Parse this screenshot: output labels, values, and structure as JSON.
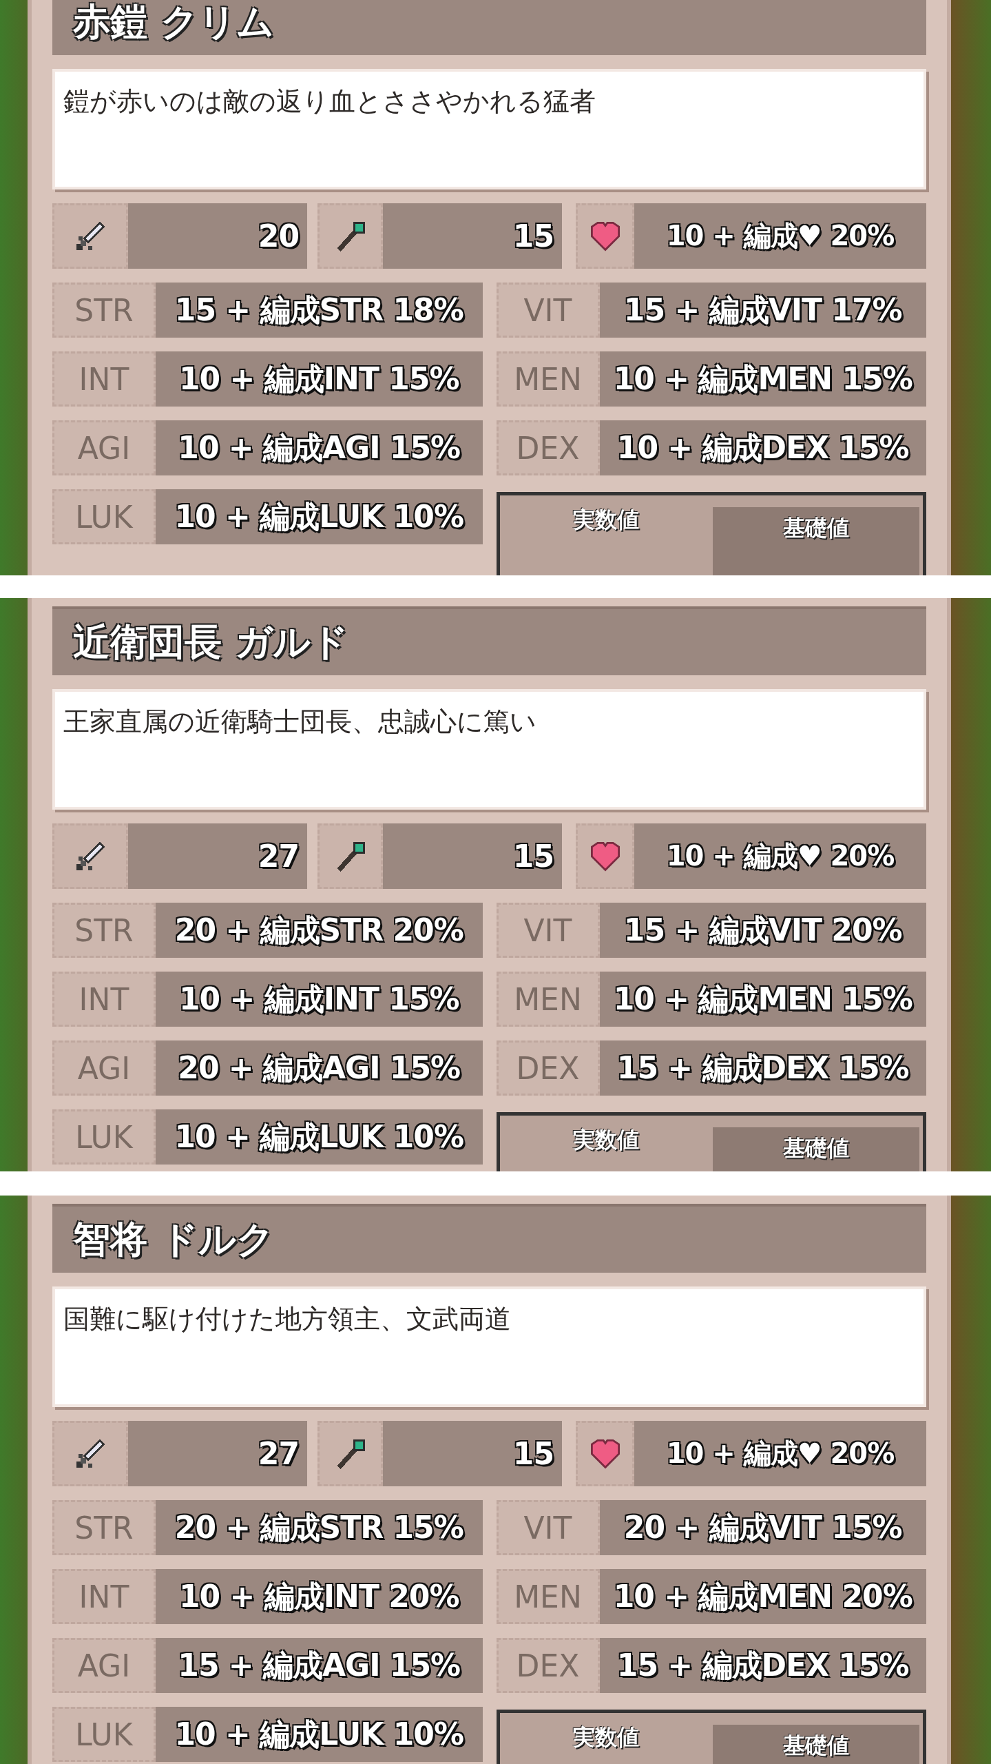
{
  "panels": [
    {
      "name": "赤鎧 クリム",
      "description": "鎧が赤いのは敵の返り血とささやかれる猛者",
      "attack": "20",
      "magic": "15",
      "hp": "10 + 編成♥ 20%",
      "stats": [
        {
          "label": "STR",
          "value": "15 + 編成STR 18%"
        },
        {
          "label": "VIT",
          "value": "15 + 編成VIT 17%"
        },
        {
          "label": "INT",
          "value": "10 + 編成INT 15%"
        },
        {
          "label": "MEN",
          "value": "10 + 編成MEN 15%"
        },
        {
          "label": "AGI",
          "value": "10 + 編成AGI 15%"
        },
        {
          "label": "DEX",
          "value": "10 + 編成DEX 15%"
        },
        {
          "label": "LUK",
          "value": "10 + 編成LUK 10%"
        }
      ],
      "toggle": [
        {
          "label": "実数値",
          "selected": true
        },
        {
          "label": "基礎値",
          "selected": false
        }
      ]
    },
    {
      "name": "近衛団長 ガルド",
      "description": "王家直属の近衛騎士団長、忠誠心に篤い",
      "attack": "27",
      "magic": "15",
      "hp": "10 + 編成♥ 20%",
      "stats": [
        {
          "label": "STR",
          "value": "20 + 編成STR 20%"
        },
        {
          "label": "VIT",
          "value": "15 + 編成VIT 20%"
        },
        {
          "label": "INT",
          "value": "10 + 編成INT 15%"
        },
        {
          "label": "MEN",
          "value": "10 + 編成MEN 15%"
        },
        {
          "label": "AGI",
          "value": "20 + 編成AGI 15%"
        },
        {
          "label": "DEX",
          "value": "15 + 編成DEX 15%"
        },
        {
          "label": "LUK",
          "value": "10 + 編成LUK 10%"
        }
      ],
      "toggle": [
        {
          "label": "実数値",
          "selected": true
        },
        {
          "label": "基礎値",
          "selected": false
        }
      ]
    },
    {
      "name": "智将 ドルク",
      "description": "国難に駆け付けた地方領主、文武両道",
      "attack": "27",
      "magic": "15",
      "hp": "10 + 編成♥ 20%",
      "stats": [
        {
          "label": "STR",
          "value": "20 + 編成STR 15%"
        },
        {
          "label": "VIT",
          "value": "20 + 編成VIT 15%"
        },
        {
          "label": "INT",
          "value": "10 + 編成INT 20%"
        },
        {
          "label": "MEN",
          "value": "10 + 編成MEN 20%"
        },
        {
          "label": "AGI",
          "value": "15 + 編成AGI 15%"
        },
        {
          "label": "DEX",
          "value": "15 + 編成DEX 15%"
        },
        {
          "label": "LUK",
          "value": "10 + 編成LUK 10%"
        }
      ],
      "toggle": [
        {
          "label": "実数値",
          "selected": true
        },
        {
          "label": "基礎値",
          "selected": false
        }
      ]
    }
  ]
}
